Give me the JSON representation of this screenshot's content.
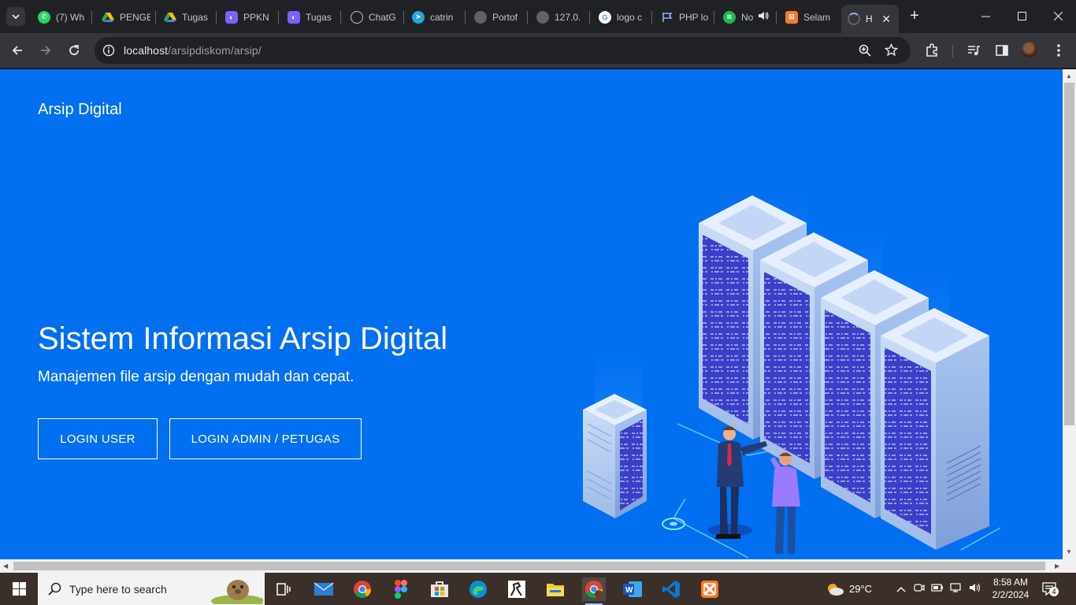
{
  "browser": {
    "tabs": [
      {
        "title": "(7) Wh",
        "favicon": "whatsapp-icon",
        "color": "#25d366"
      },
      {
        "title": "PENGE",
        "favicon": "drive-icon",
        "color": "#f4b400"
      },
      {
        "title": "Tugas",
        "favicon": "drive-icon",
        "color": "#f4b400"
      },
      {
        "title": "PPKN",
        "favicon": "classroom-icon",
        "color": "#7b61ff"
      },
      {
        "title": "Tugas",
        "favicon": "classroom-icon",
        "color": "#7b61ff"
      },
      {
        "title": "ChatG",
        "favicon": "chatgpt-icon",
        "color": "#5f6368"
      },
      {
        "title": "catrin",
        "favicon": "telegram-icon",
        "color": "#2aa3df"
      },
      {
        "title": "Portof",
        "favicon": "globe-icon",
        "color": "#5f6368"
      },
      {
        "title": "127.0.",
        "favicon": "globe-icon",
        "color": "#5f6368"
      },
      {
        "title": "logo c",
        "favicon": "google-icon",
        "color": "#ffffff"
      },
      {
        "title": "PHP lo",
        "favicon": "flag-icon",
        "color": "#8ab4f8"
      },
      {
        "title": "No",
        "favicon": "spotify-icon",
        "color": "#1db954"
      },
      {
        "title": "Selam",
        "favicon": "xampp-icon",
        "color": "#fb7a24"
      },
      {
        "title": "H",
        "favicon": "loading-icon",
        "color": "#5f6368"
      }
    ],
    "url_host": "localhost",
    "url_path": "/arsipdiskom/arsip/"
  },
  "page": {
    "brand": "Arsip Digital",
    "hero_title": "Sistem Informasi Arsip Digital",
    "hero_subtitle": "Manajemen file arsip dengan mudah dan cepat.",
    "login_user_label": "LOGIN USER",
    "login_admin_label": "LOGIN ADMIN / PETUGAS",
    "background_color": "#006ff0"
  },
  "taskbar": {
    "search_placeholder": "Type here to search",
    "weather": "29°C",
    "time": "8:58 AM",
    "date": "2/2/2024",
    "notification_count": "4"
  }
}
